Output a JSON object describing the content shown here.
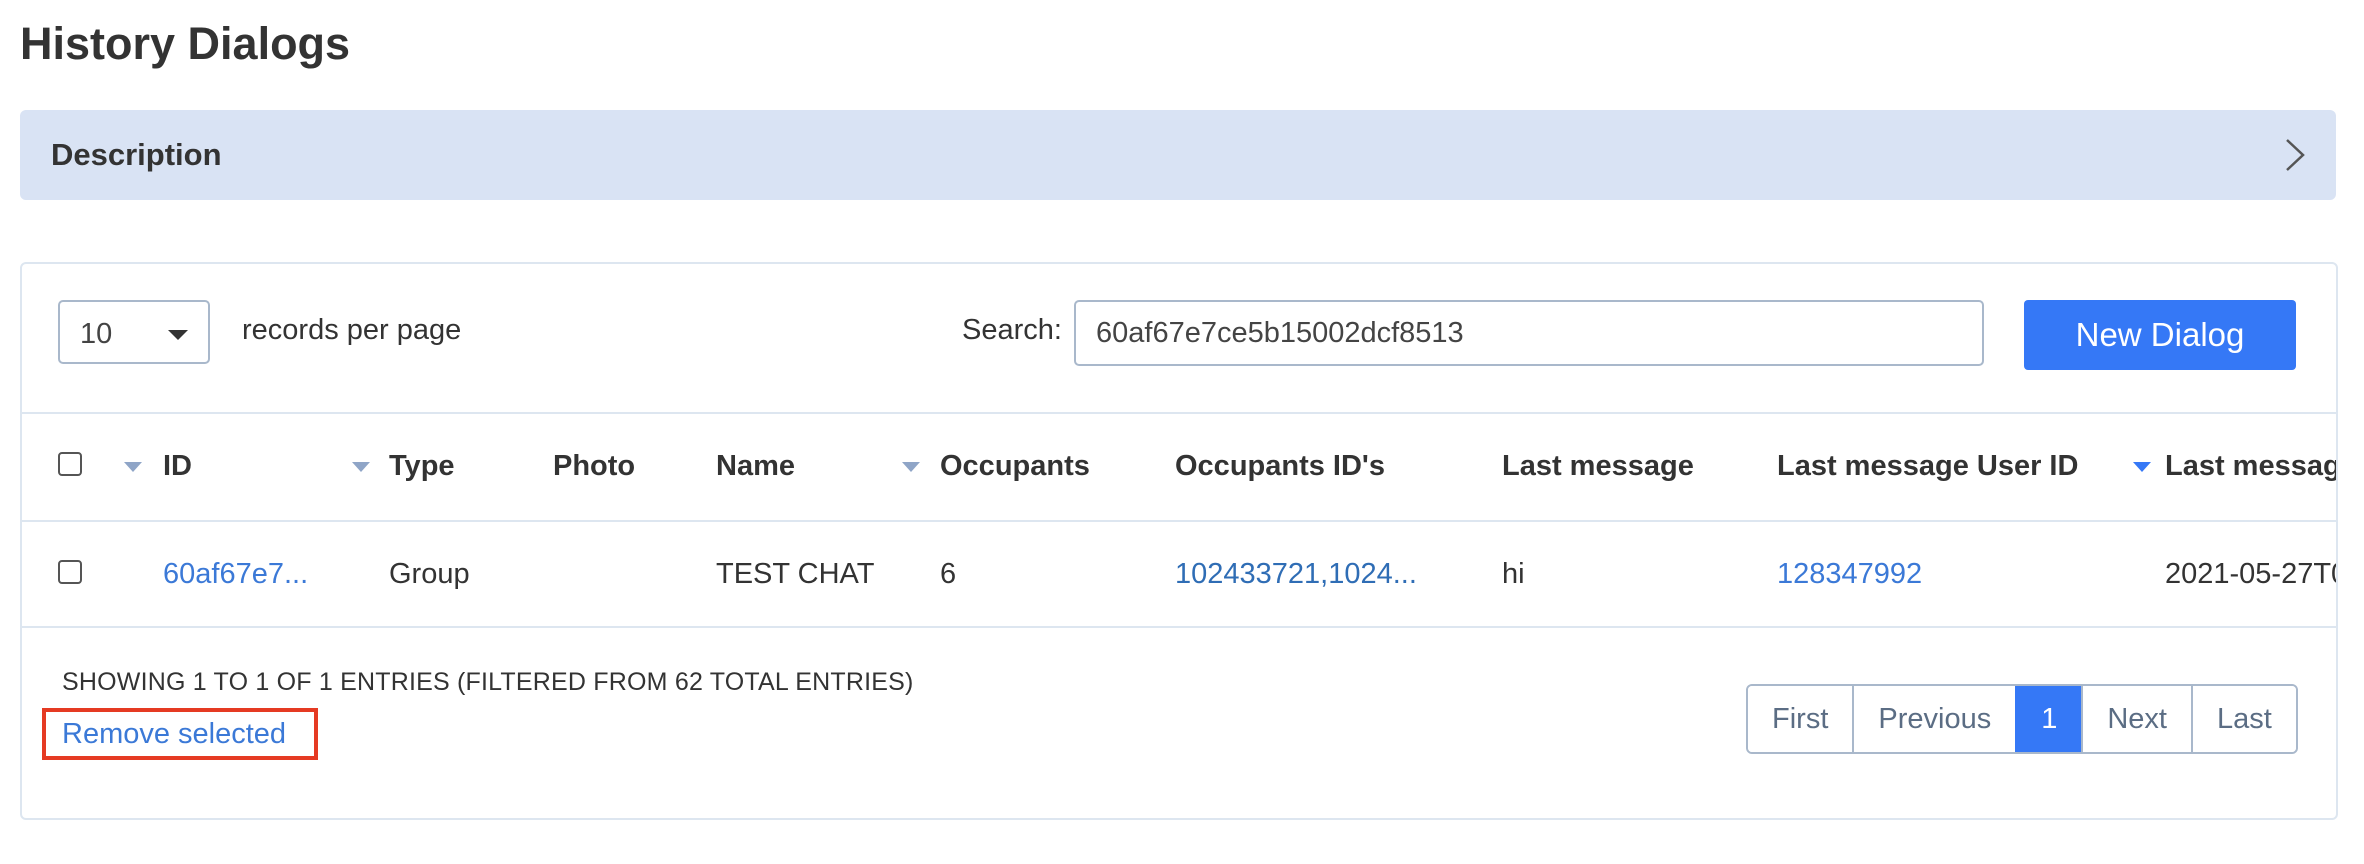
{
  "page_title": "History Dialogs",
  "description_panel": {
    "title": "Description",
    "chevron_icon": "chevron-right-icon"
  },
  "toolbar": {
    "records_per_page_value": "10",
    "records_per_page_label": "records per page",
    "search_label": "Search:",
    "search_value": "60af67e7ce5b15002dcf8513",
    "new_dialog_label": "New Dialog"
  },
  "table": {
    "columns": [
      "ID",
      "Type",
      "Photo",
      "Name",
      "Occupants",
      "Occupants ID's",
      "Last message",
      "Last message User ID",
      "Last messag"
    ],
    "rows": [
      {
        "id": "60af67e7...",
        "type": "Group",
        "photo": "",
        "name": "TEST CHAT",
        "occupants": "6",
        "occupants_ids": "102433721,1024...",
        "last_message": "hi",
        "last_message_user_id": "128347992",
        "last_message_date": "2021-05-27T0"
      }
    ]
  },
  "footer": {
    "info": "SHOWING 1 TO 1 OF 1 ENTRIES (FILTERED FROM 62 TOTAL ENTRIES)",
    "remove_selected": "Remove selected"
  },
  "pagination": {
    "first": "First",
    "previous": "Previous",
    "current": "1",
    "next": "Next",
    "last": "Last"
  },
  "colors": {
    "accent": "#3578f6",
    "link": "#3b79d7",
    "panel": "#d9e3f4",
    "highlight": "#e53a23"
  }
}
